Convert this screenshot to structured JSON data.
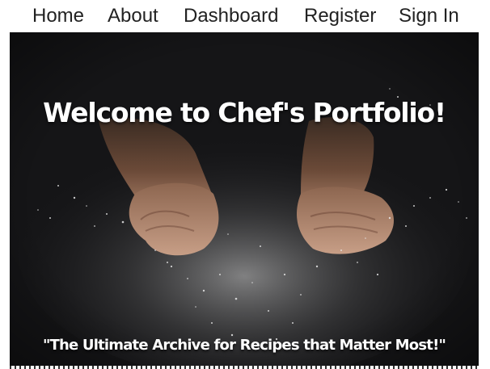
{
  "nav": {
    "items": [
      {
        "label": "Home"
      },
      {
        "label": "About"
      },
      {
        "label": "Dashboard"
      },
      {
        "label": "Register"
      },
      {
        "label": "Sign In"
      }
    ]
  },
  "hero": {
    "title": "Welcome to Chef's Portfolio!",
    "tagline": "\"The Ultimate Archive for Recipes that Matter Most!\"",
    "image": "hands-releasing-flour-photo"
  },
  "colors": {
    "nav_text": "#222222",
    "hero_text": "#ffffff",
    "hero_background": "#141416"
  }
}
